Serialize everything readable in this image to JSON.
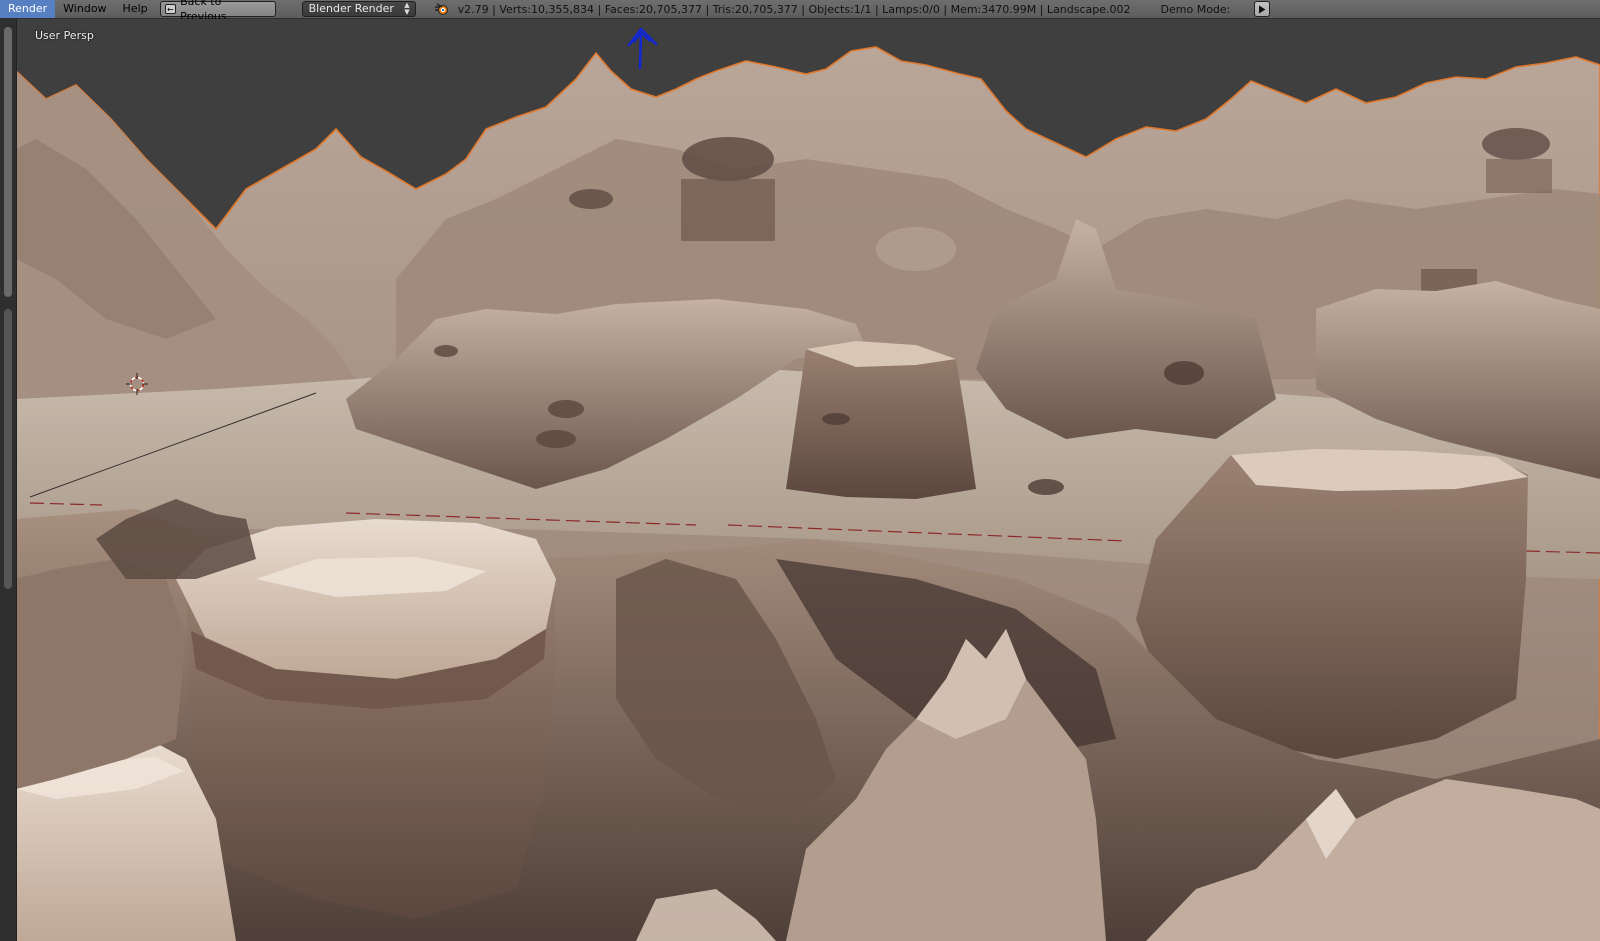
{
  "menu": {
    "items": [
      "Render",
      "Window",
      "Help"
    ],
    "active": "Render"
  },
  "toolbar": {
    "back_label": "Back to Previous",
    "engine": "Blender Render"
  },
  "stats": "v2.79 | Verts:10,355,834 | Faces:20,705,377 | Tris:20,705,377 | Objects:1/1 | Lamps:0/0 | Mem:3470.99M | Landscape.002",
  "demo_mode_label": "Demo Mode:",
  "viewport": {
    "label": "User Persp"
  },
  "colors": {
    "header_bg": "#646464",
    "menu_active": "#5680c2",
    "viewport_bg": "#3f3f3f",
    "selection_outline": "#e0782c",
    "terrain_light": "#d8c8b8",
    "terrain_mid": "#a89282",
    "terrain_dark": "#5e4c44",
    "axis_red": "#8c2a2a",
    "arrow_blue": "#1228d0"
  },
  "icons": {
    "back": "back-arrow-icon",
    "engine_dropdown": "up-down-arrows-icon",
    "logo": "blender-logo-icon",
    "play": "play-icon",
    "cursor": "3d-cursor-icon",
    "annotation": "blue-arrow-icon"
  }
}
